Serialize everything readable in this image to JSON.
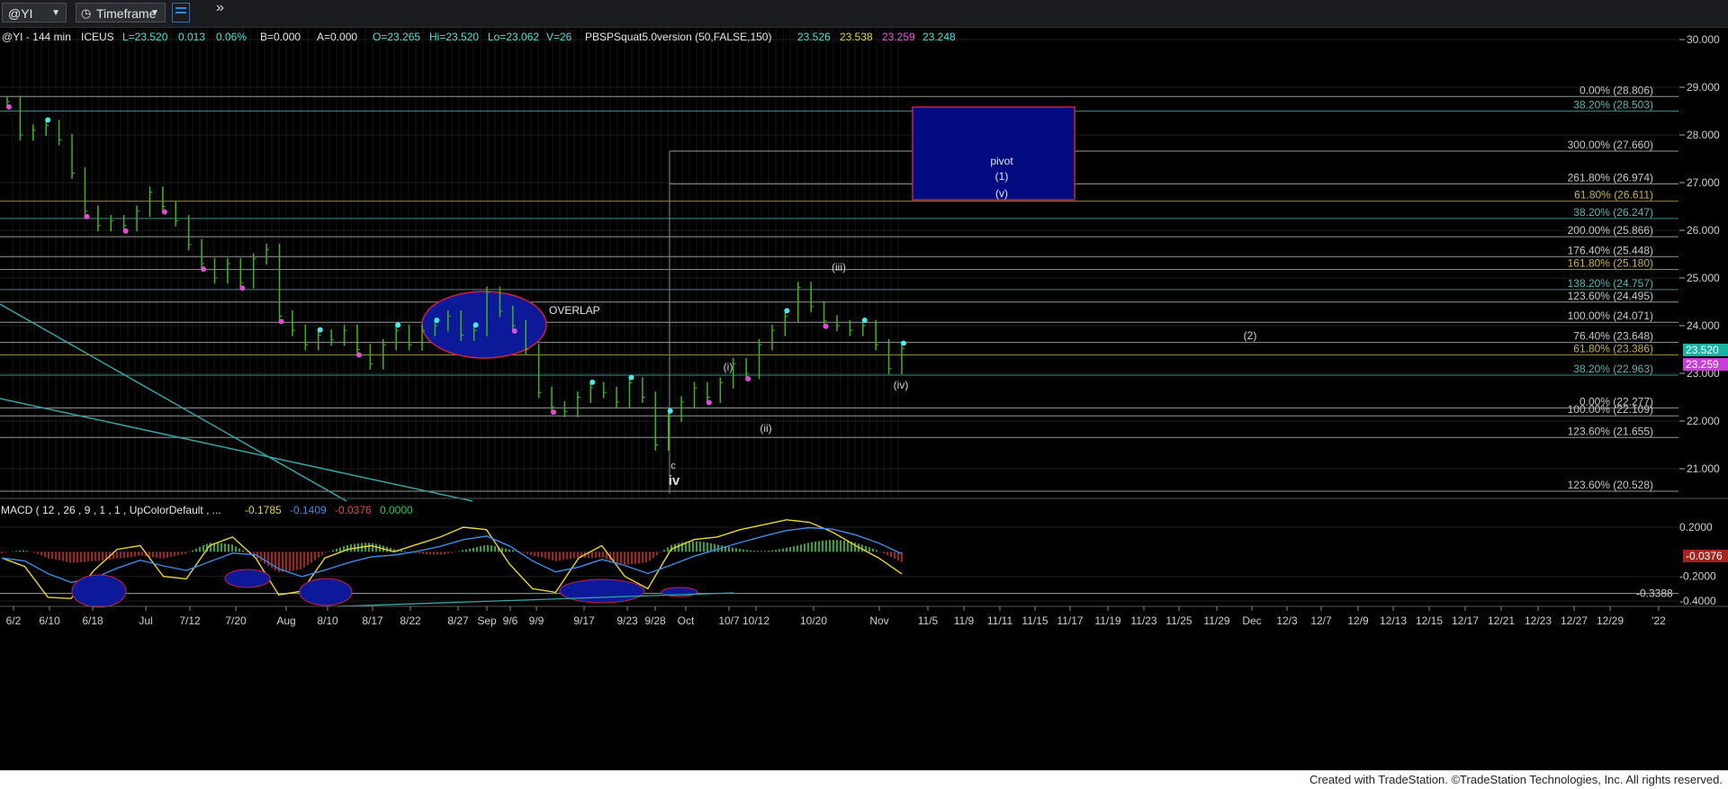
{
  "toolbar": {
    "symbol": "@YI",
    "timeframe_label": "Timeframe",
    "more_label": "»"
  },
  "header": {
    "study_prefix": "@YI - 144 min",
    "exchange": "ICEUS",
    "last": "L=23.520",
    "change": "0.013",
    "change_pct": "0.06%",
    "bid": "B=0.000",
    "ask": "A=0.000",
    "open": "O=23.265",
    "high": "Hi=23.520",
    "low": "Lo=23.062",
    "volume": "V=26",
    "indicator": "PBSPSquat5.0version (50,FALSE,150)",
    "ind_values": [
      "23.526",
      "23.538",
      "23.259",
      "23.248"
    ]
  },
  "macd_header": {
    "label": "MACD ( 12 , 26 , 9 , 1 , 1 , UpColorDefault , ...",
    "values": [
      "-0.1785",
      "-0.1409",
      "-0.0376",
      "0.0000"
    ]
  },
  "price_axis": {
    "ticks": [
      "30.000",
      "29.000",
      "28.000",
      "27.000",
      "26.000",
      "25.000",
      "24.000",
      "23.000",
      "22.000",
      "21.000"
    ],
    "tick_values": [
      30,
      29,
      28,
      27,
      26,
      25,
      24,
      23,
      22,
      21
    ],
    "last_price_tag": "23.520",
    "last_price": 23.52,
    "magenta_tag": "23.259",
    "magenta_price": 23.259
  },
  "macd_axis": {
    "ticks": [
      "0.2000",
      "-0.2000",
      "-0.3388",
      "-0.4000"
    ],
    "tick_values": [
      0.2,
      -0.2,
      -0.3388,
      -0.4
    ],
    "value_tag": "-0.0376"
  },
  "date_axis": {
    "labels": [
      "6/2",
      "6/10",
      "6/18",
      "Jul",
      "7/12",
      "7/20",
      "Aug",
      "8/10",
      "8/17",
      "8/22",
      "8/27",
      "Sep",
      "9/6",
      "9/9",
      "9/17",
      "9/23",
      "9/28",
      "Oct",
      "10/7",
      "10/12",
      "10/20",
      "Nov",
      "11/5",
      "11/9",
      "11/11",
      "11/15",
      "11/17",
      "11/19",
      "11/23",
      "11/25",
      "11/29",
      "Dec",
      "12/3",
      "12/7",
      "12/9",
      "12/13",
      "12/15",
      "12/17",
      "12/21",
      "12/23",
      "12/27",
      "12/29",
      "'22"
    ]
  },
  "fib_labels": [
    {
      "text": "0.00% (28.806)",
      "price": 28.806,
      "color": "#c9c9c9"
    },
    {
      "text": "38.20% (28.503)",
      "price": 28.503,
      "color": "#5fb5b5"
    },
    {
      "text": "300.00% (27.660)",
      "price": 27.66,
      "color": "#c9c9c9"
    },
    {
      "text": "261.80% (26.974)",
      "price": 26.974,
      "color": "#c9c9c9"
    },
    {
      "text": "61.80% (26.611)",
      "price": 26.611,
      "color": "#c8b24a"
    },
    {
      "text": "38.20% (26.247)",
      "price": 26.247,
      "color": "#5fb5b5"
    },
    {
      "text": "200.00% (25.866)",
      "price": 25.866,
      "color": "#c9c9c9"
    },
    {
      "text": "176.40% (25.448)",
      "price": 25.448,
      "color": "#c9c9c9"
    },
    {
      "text": "161.80% (25.180)",
      "price": 25.18,
      "color": "#c8b24a"
    },
    {
      "text": "138.20% (24.757)",
      "price": 24.757,
      "color": "#5fb5b5"
    },
    {
      "text": "123.60% (24.495)",
      "price": 24.495,
      "color": "#c9c9c9"
    },
    {
      "text": "100.00% (24.071)",
      "price": 24.071,
      "color": "#c9c9c9"
    },
    {
      "text": "76.40% (23.648)",
      "price": 23.648,
      "color": "#c9c9c9"
    },
    {
      "text": "61.80% (23.386)",
      "price": 23.386,
      "color": "#c8b24a"
    },
    {
      "text": "38.20% (22.963)",
      "price": 22.963,
      "color": "#5fb5b5"
    },
    {
      "text": "0.00% (22.277)",
      "price": 22.277,
      "color": "#c9c9c9"
    },
    {
      "text": "100.00% (22.109)",
      "price": 22.109,
      "color": "#c9c9c9"
    },
    {
      "text": "123.60% (21.655)",
      "price": 21.655,
      "color": "#c9c9c9"
    },
    {
      "text": "123.60% (20.528)",
      "price": 20.528,
      "color": "#c9c9c9"
    }
  ],
  "annotations": {
    "overlap": "OVERLAP",
    "pivot": "pivot",
    "wave_1": "(1)",
    "wave_v": "(v)",
    "wave_2": "(2)",
    "wave_iii": "(iii)",
    "wave_iv": "(iv)",
    "wave_i": "(i)",
    "wave_ii": "(ii)",
    "wave_c": "c",
    "wave_big_iv": "iv"
  },
  "price_series": [
    28.7,
    28.0,
    28.1,
    28.2,
    27.9,
    27.2,
    26.4,
    26.1,
    26.2,
    26.1,
    26.4,
    26.8,
    26.5,
    26.2,
    25.7,
    25.3,
    25.0,
    25.3,
    24.9,
    25.4,
    25.6,
    24.2,
    23.9,
    23.6,
    23.8,
    23.7,
    23.9,
    23.5,
    23.2,
    23.6,
    23.9,
    23.6,
    23.9,
    24.0,
    24.2,
    23.8,
    23.9,
    24.7,
    24.3,
    24.0,
    23.5,
    22.6,
    22.3,
    22.2,
    22.5,
    22.7,
    22.6,
    22.4,
    22.8,
    22.5,
    21.5,
    22.1,
    22.4,
    22.7,
    22.5,
    22.8,
    23.2,
    23.0,
    23.6,
    23.9,
    24.2,
    24.8,
    24.4,
    24.1,
    24.0,
    23.9,
    24.0,
    23.6,
    23.1,
    23.52
  ],
  "macd_series": [
    -0.05,
    -0.12,
    -0.37,
    -0.38,
    -0.15,
    0.02,
    0.05,
    -0.2,
    -0.22,
    0.05,
    0.12,
    -0.05,
    -0.35,
    -0.32,
    -0.05,
    0.02,
    0.05,
    0.0,
    0.06,
    0.12,
    0.2,
    0.18,
    -0.1,
    -0.3,
    -0.33,
    -0.05,
    0.05,
    -0.2,
    -0.3,
    0.02,
    0.1,
    0.12,
    0.18,
    0.22,
    0.26,
    0.24,
    0.16,
    0.05,
    -0.05,
    -0.18
  ],
  "colors": {
    "background": "#000000",
    "bar": "#43b21a",
    "cyan_dot": "#4ee8ea",
    "magenta_dot": "#e24bd9",
    "pivot_box": "#020b80",
    "pivot_border": "#c8233b",
    "overlap_ellipse": "#0c1a9a",
    "last_price": "#19b3a6",
    "magenta_tag": "#c83fd7",
    "macd_line": "#e9d43a",
    "signal_line": "#3f8be6",
    "hist_up": "#2fa53a",
    "hist_down": "#a3231e"
  },
  "footer": {
    "text": "Created with TradeStation. ©TradeStation Technologies, Inc. All rights reserved."
  }
}
